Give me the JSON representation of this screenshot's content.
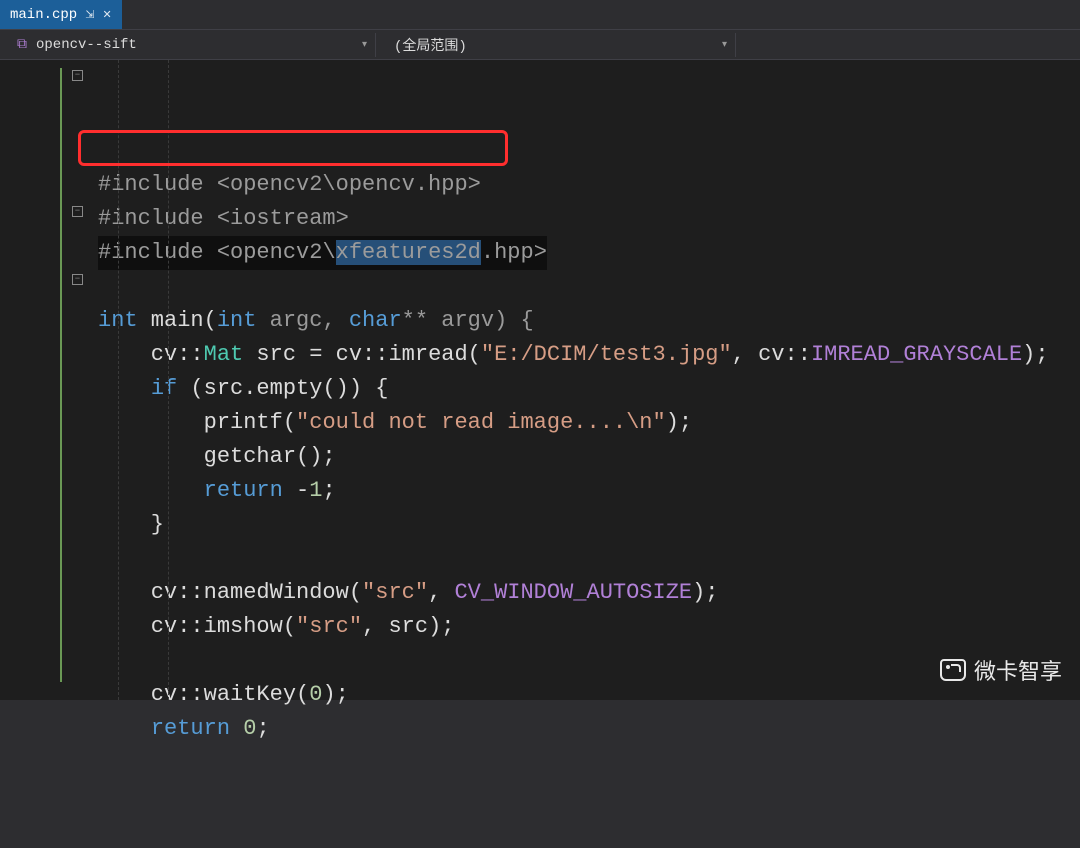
{
  "tab": {
    "filename": "main.cpp",
    "pin_glyph": "⇲",
    "close_glyph": "✕"
  },
  "nav": {
    "scope_left": "opencv--sift",
    "scope_mid": "(全局范围)"
  },
  "code": {
    "l1": "#include <opencv2\\opencv.hpp>",
    "l2": "#include <iostream>",
    "l3_pre": "#",
    "l3_inc": "include ",
    "l3_a": "<opencv2\\",
    "l3_sel": "xfeatures2d",
    "l3_b": ".hpp>",
    "l5_a": "int",
    "l5_b": " main(",
    "l5_c": "int",
    "l5_d": " argc, ",
    "l5_e": "char",
    "l5_f": "** argv) {",
    "l6_a": "    cv::",
    "l6_b": "Mat",
    "l6_c": " src = cv::imread(",
    "l6_d": "\"E:/DCIM/test3.jpg\"",
    "l6_e": ", cv::",
    "l6_f": "IMREAD_GRAYSCALE",
    "l6_g": ");",
    "l7_a": "    ",
    "l7_b": "if",
    "l7_c": " (src.empty()) {",
    "l8_a": "        printf(",
    "l8_b": "\"could not read image....\\n\"",
    "l8_c": ");",
    "l9": "        getchar();",
    "l10_a": "        ",
    "l10_b": "return",
    "l10_c": " -",
    "l10_d": "1",
    "l10_e": ";",
    "l11": "    }",
    "l13_a": "    cv::namedWindow(",
    "l13_b": "\"src\"",
    "l13_c": ", ",
    "l13_d": "CV_WINDOW_AUTOSIZE",
    "l13_e": ");",
    "l14_a": "    cv::imshow(",
    "l14_b": "\"src\"",
    "l14_c": ", src);",
    "l16_a": "    cv::waitKey(",
    "l16_b": "0",
    "l16_c": ");",
    "l17_a": "    ",
    "l17_b": "return",
    "l17_c": " ",
    "l17_d": "0",
    "l17_e": ";"
  },
  "watermark": "微卡智享"
}
